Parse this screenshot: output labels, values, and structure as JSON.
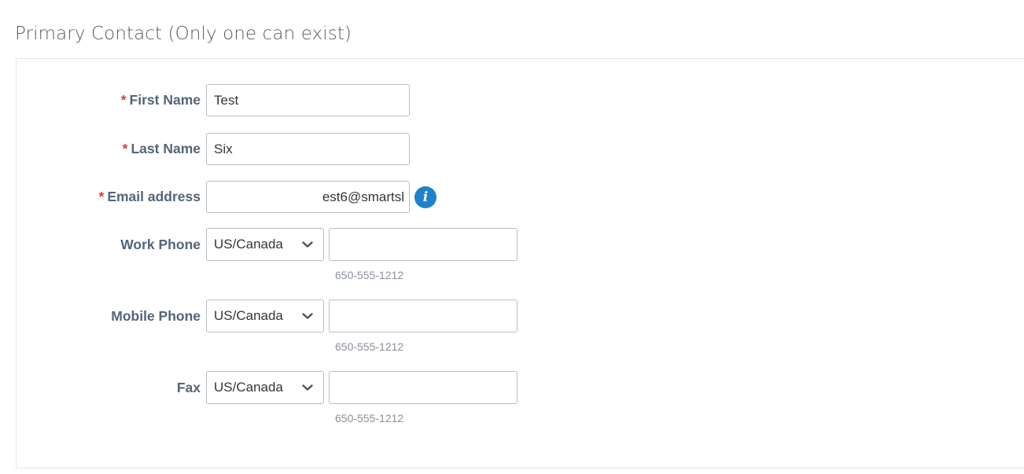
{
  "section": {
    "title": "Primary Contact (Only one can exist)"
  },
  "form": {
    "required_marker": "*",
    "first_name": {
      "label": "First Name",
      "value": "Test"
    },
    "last_name": {
      "label": "Last Name",
      "value": "Six"
    },
    "email": {
      "label": "Email address",
      "value": "est6@smartsl",
      "info_icon": "info-icon"
    },
    "work_phone": {
      "label": "Work Phone",
      "country": "US/Canada",
      "value": "",
      "hint": "650-555-1212"
    },
    "mobile_phone": {
      "label": "Mobile Phone",
      "country": "US/Canada",
      "value": "",
      "hint": "650-555-1212"
    },
    "fax": {
      "label": "Fax",
      "country": "US/Canada",
      "value": "",
      "hint": "650-555-1212"
    }
  },
  "colors": {
    "label": "#53657a",
    "required": "#d8432a",
    "info_icon": "#1d82c9",
    "border": "#b7bec6",
    "hint": "#8a9099"
  }
}
